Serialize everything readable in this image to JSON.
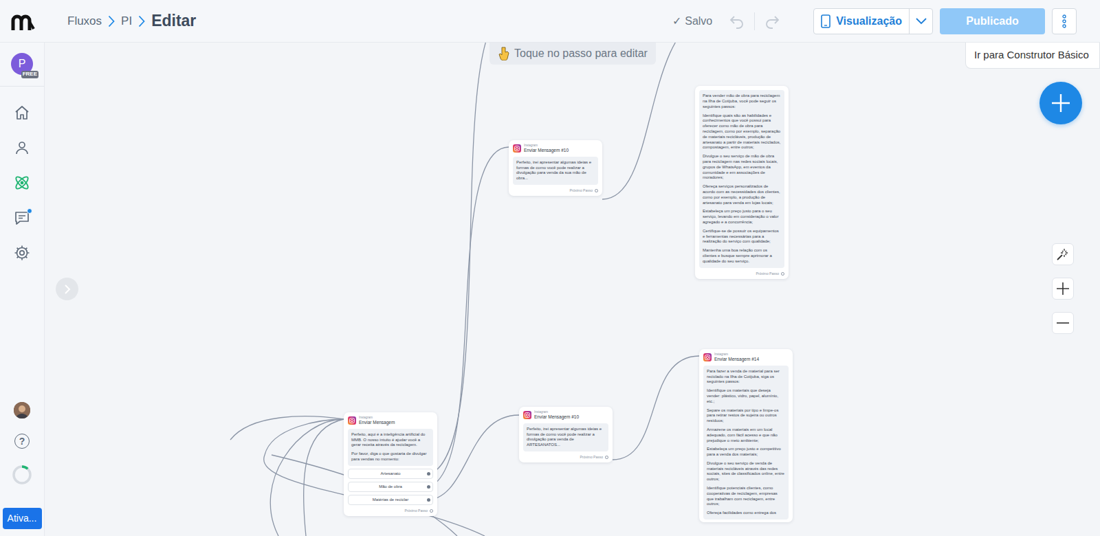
{
  "breadcrumb": [
    {
      "label": "Fluxos",
      "selected": false
    },
    {
      "label": "PI",
      "selected": false
    },
    {
      "label": "Editar",
      "selected": true
    }
  ],
  "save_status": {
    "icon": "✓",
    "label": "Salvo"
  },
  "preview_button": {
    "label": "Visualização"
  },
  "publish_button": {
    "label": "Publicado",
    "disabled": true
  },
  "more_menu": {
    "items": [
      {
        "label": "Ir para Construtor Básico"
      }
    ]
  },
  "sidebar": {
    "account": {
      "initial": "P",
      "plan": "FREE"
    },
    "items": [
      {
        "kind": "home",
        "selected": false,
        "badge": false
      },
      {
        "kind": "contacts",
        "selected": false,
        "badge": false
      },
      {
        "kind": "automation",
        "selected": true,
        "badge": false
      },
      {
        "kind": "chat",
        "selected": false,
        "badge": true
      },
      {
        "kind": "settings",
        "selected": false,
        "badge": false
      }
    ],
    "help": {
      "label": "?"
    },
    "usage": {
      "level": 0.12
    },
    "plan_button": {
      "label": "Ativa..."
    }
  },
  "canvas": {
    "hint": {
      "label": "Toque no passo para editar"
    },
    "nodes": [
      {
        "text": [
          "Para vender mão de obra para reciclagem na Ilha de Cotijuba, você pode seguir os seguintes passos:",
          "Identifique quais são as habilidades e conhecimentos que você possui para oferecer como mão de obra para reciclagem, como por exemplo, separação de materiais recicláveis, produção de artesanato a partir de materiais reciclados, compostagem, entre outros;",
          "Divulgue o seu serviço de mão de obra para reciclagem nas redes sociais locais, grupos de WhatsApp, em eventos da comunidade e em associações de moradores;",
          "Ofereça serviços personalizados de acordo com as necessidades dos clientes, como por exemplo, a produção de artesanato para venda em lojas locais;",
          "Estabeleça um preço justo para o seu serviço, levando em consideração o valor agregado e a concorrência;",
          "Certifique-se de possuir os equipamentos e ferramentas necessárias para a realização do serviço com qualidade;",
          "Mantenha uma boa relação com os clientes e busque sempre aprimorar a qualidade do seu serviço."
        ],
        "buttons": [],
        "next": "Próximo Passo"
      },
      {
        "channel": "Instagram",
        "title": "Enviar Mensagem #10",
        "text": [
          "Perfeito, irei apresentar algumas ideias e formas de como você pode realizar a divulgação para venda da sua mão de obra..."
        ],
        "buttons": [],
        "next": "Próximo Passo"
      },
      {
        "channel": "Instagram",
        "title": "Enviar Mensagem #10",
        "text": [
          "Perfeito, irei apresentar algumas ideias e formas de como você pode realizar a divulgação para venda de ARTESANATOS..."
        ],
        "buttons": [],
        "next": "Próximo Passo"
      },
      {
        "channel": "Instagram",
        "title": "Enviar Mensagem",
        "text": [
          "Perfeito, aqui é a inteligência artificial do MMB. O nosso intuito é ajudar você a gerar receita através da reciclagem.",
          "Por favor, diga o que gostaria de divulgar para vendas no momento:"
        ],
        "buttons": [
          "Artesanato",
          "Mão de obra",
          "Matérias de reciclar"
        ],
        "next": "Próximo Passo"
      },
      {
        "channel": "Instagram",
        "title": "Enviar Mensagem #14",
        "text": [
          "Para fazer a venda de material para ser reciclado na Ilha de Cotijuba, siga os seguintes passos:",
          "Identifique os materiais que deseja vender: plástico, vidro, papel, alumínio, etc.;",
          "Separe os materiais por tipo e limpe-os para retirar restos de sujeira ou outros resíduos;",
          "Armazene os materiais em um local adequado, com fácil acesso e que não prejudique o meio ambiente;",
          "Estabeleça um preço justo e competitivo para a venda dos materiais;",
          "Divulgue o seu serviço de venda de materiais recicláveis através das redes sociais, sites de classificados online, entre outros;",
          "Identifique potenciais clientes, como cooperativas de reciclagem, empresas que trabalham com reciclagem, entre outros;",
          "Ofereça facilidades como entrega dos"
        ],
        "buttons": []
      }
    ]
  }
}
